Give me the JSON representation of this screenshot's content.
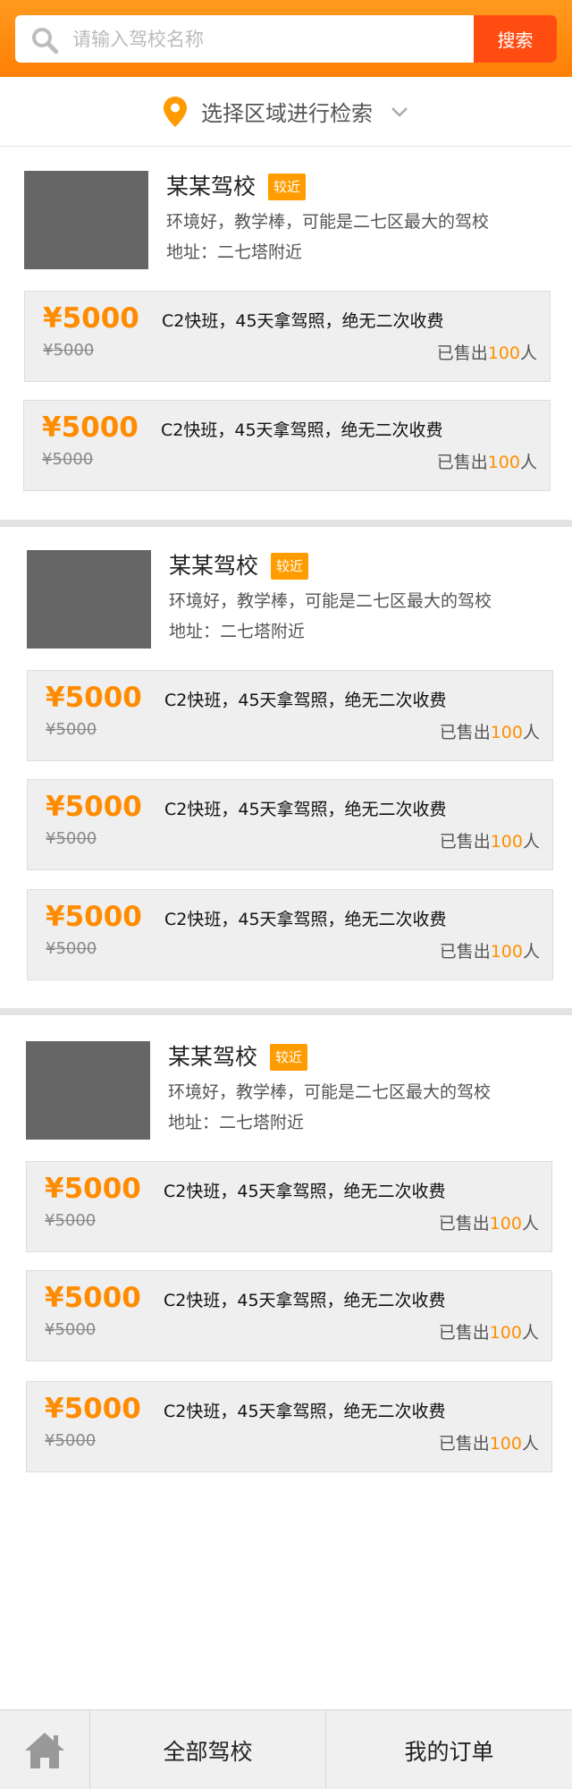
{
  "search": {
    "placeholder": "请输入驾校名称",
    "button_label": "搜索"
  },
  "region": {
    "label": "选择区域进行检索"
  },
  "schools": [
    {
      "name": "某某驾校",
      "badge": "较近",
      "description": "环境好，教学棒，可能是二七区最大的驾校",
      "address": "地址：二七塔附近",
      "offers": [
        {
          "price": "¥5000",
          "original_price": "¥5000",
          "title": "C2快班，45天拿驾照，绝无二次收费",
          "sold_prefix": "已售出",
          "sold_count": "100",
          "sold_suffix": "人"
        },
        {
          "price": "¥5000",
          "original_price": "¥5000",
          "title": "C2快班，45天拿驾照，绝无二次收费",
          "sold_prefix": "已售出",
          "sold_count": "100",
          "sold_suffix": "人"
        }
      ]
    },
    {
      "name": "某某驾校",
      "badge": "较近",
      "description": "环境好，教学棒，可能是二七区最大的驾校",
      "address": "地址：二七塔附近",
      "offers": [
        {
          "price": "¥5000",
          "original_price": "¥5000",
          "title": "C2快班，45天拿驾照，绝无二次收费",
          "sold_prefix": "已售出",
          "sold_count": "100",
          "sold_suffix": "人"
        },
        {
          "price": "¥5000",
          "original_price": "¥5000",
          "title": "C2快班，45天拿驾照，绝无二次收费",
          "sold_prefix": "已售出",
          "sold_count": "100",
          "sold_suffix": "人"
        },
        {
          "price": "¥5000",
          "original_price": "¥5000",
          "title": "C2快班，45天拿驾照，绝无二次收费",
          "sold_prefix": "已售出",
          "sold_count": "100",
          "sold_suffix": "人"
        }
      ]
    },
    {
      "name": "某某驾校",
      "badge": "较近",
      "description": "环境好，教学棒，可能是二七区最大的驾校",
      "address": "地址：二七塔附近",
      "offers": [
        {
          "price": "¥5000",
          "original_price": "¥5000",
          "title": "C2快班，45天拿驾照，绝无二次收费",
          "sold_prefix": "已售出",
          "sold_count": "100",
          "sold_suffix": "人"
        },
        {
          "price": "¥5000",
          "original_price": "¥5000",
          "title": "C2快班，45天拿驾照，绝无二次收费",
          "sold_prefix": "已售出",
          "sold_count": "100",
          "sold_suffix": "人"
        },
        {
          "price": "¥5000",
          "original_price": "¥5000",
          "title": "C2快班，45天拿驾照，绝无二次收费",
          "sold_prefix": "已售出",
          "sold_count": "100",
          "sold_suffix": "人"
        }
      ]
    }
  ],
  "tabbar": {
    "home_icon": "home-icon",
    "tab1": "全部驾校",
    "tab2": "我的订单"
  },
  "colors": {
    "header": "#ff8c0d",
    "search_button": "#ff4d12",
    "accent": "#ff9000",
    "thumbnail": "#666666"
  }
}
